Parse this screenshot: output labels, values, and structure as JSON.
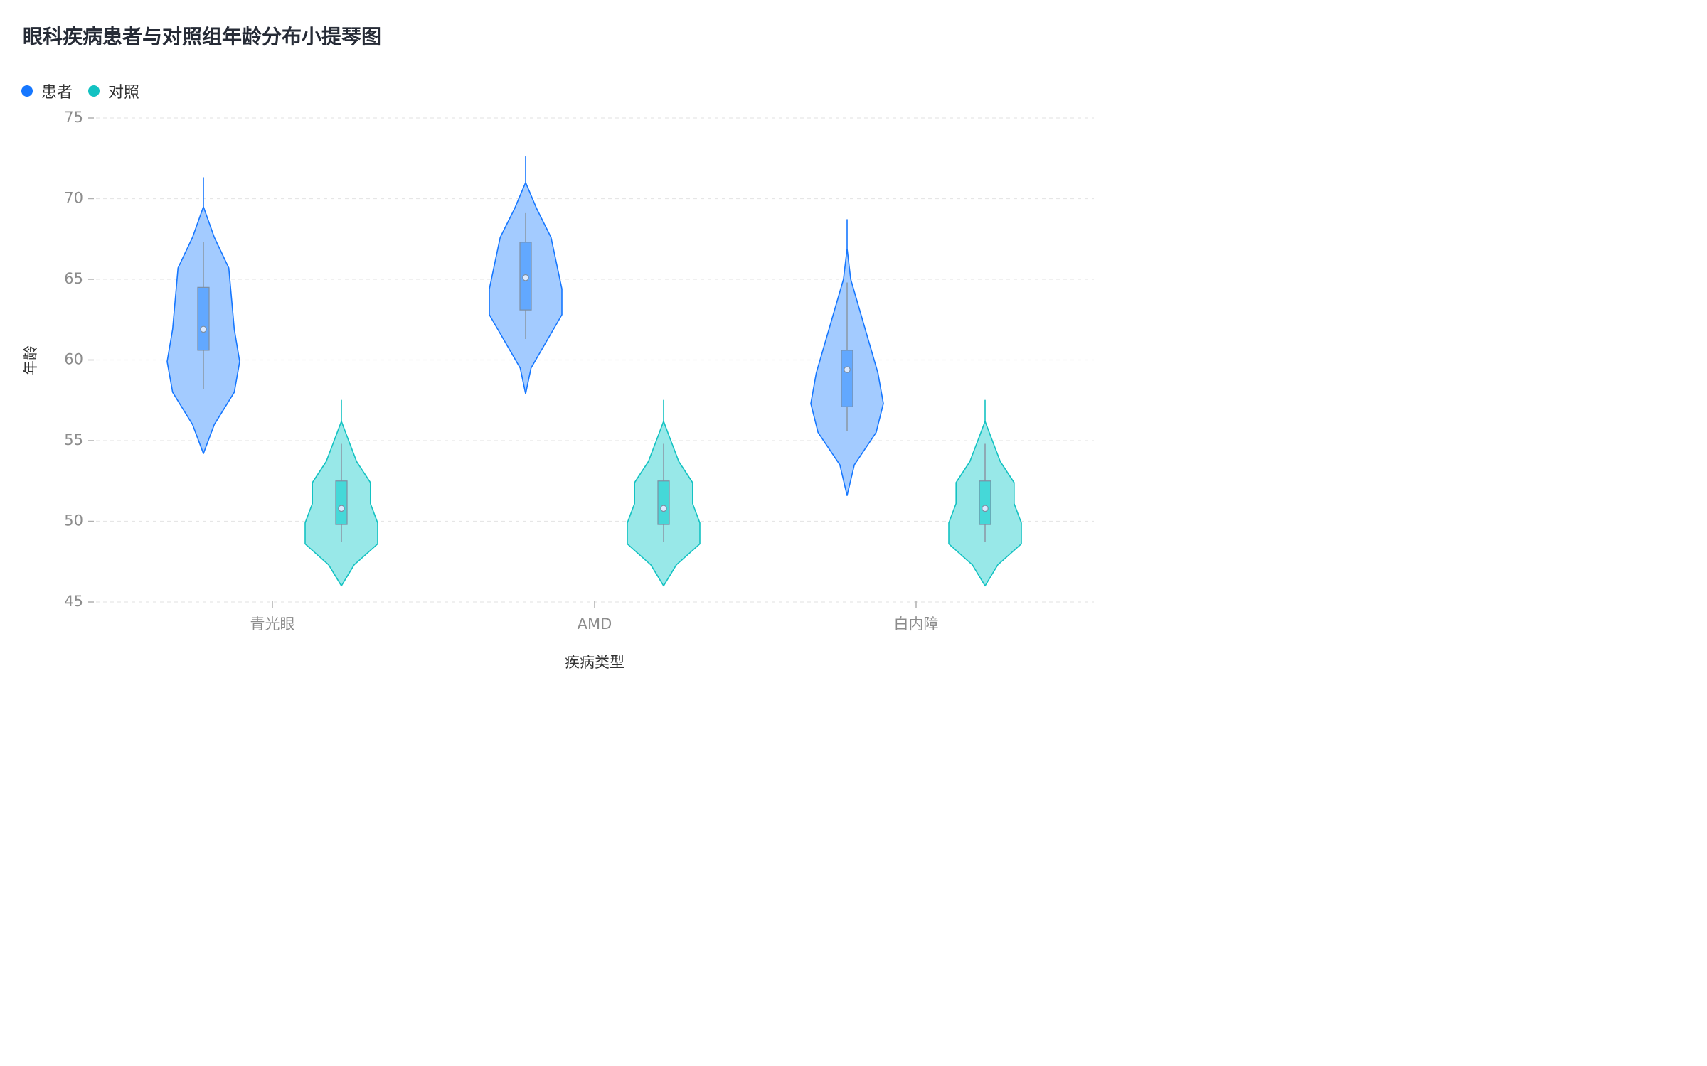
{
  "chart_data": {
    "type": "violin",
    "title": "眼科疾病患者与对照组年龄分布小提琴图",
    "xlabel": "疾病类型",
    "ylabel": "年龄",
    "ylim": [
      45,
      75
    ],
    "yticks": [
      45,
      50,
      55,
      60,
      65,
      70,
      75
    ],
    "grid": "horizontal dashed",
    "legend_position": "top-left",
    "categories": [
      "青光眼",
      "AMD",
      "白内障"
    ],
    "series": [
      {
        "name": "患者",
        "color": "#1677ff",
        "fill": "#a3cbff",
        "box_fill": "#62a8ff",
        "stats": [
          {
            "min": 54.2,
            "max": 71.3,
            "whisker_low": 58.2,
            "whisker_high": 67.3,
            "q1": 60.6,
            "q3": 64.5,
            "mean": 61.9,
            "density": [
              [
                54.2,
                0
              ],
              [
                56.0,
                0.3
              ],
              [
                58.0,
                0.85
              ],
              [
                59.9,
                1.0
              ],
              [
                61.9,
                0.85
              ],
              [
                65.7,
                0.7
              ],
              [
                67.6,
                0.3
              ],
              [
                69.5,
                0
              ],
              [
                71.3,
                0
              ]
            ]
          },
          {
            "min": 57.9,
            "max": 72.6,
            "whisker_low": 61.3,
            "whisker_high": 69.1,
            "q1": 63.1,
            "q3": 67.3,
            "mean": 65.1,
            "density": [
              [
                57.9,
                0
              ],
              [
                59.5,
                0.15
              ],
              [
                62.8,
                1.0
              ],
              [
                64.4,
                1.0
              ],
              [
                67.6,
                0.7
              ],
              [
                69.4,
                0.3
              ],
              [
                71.0,
                0
              ],
              [
                72.6,
                0
              ]
            ]
          },
          {
            "min": 51.6,
            "max": 68.7,
            "whisker_low": 55.6,
            "whisker_high": 64.8,
            "q1": 57.1,
            "q3": 60.6,
            "mean": 59.4,
            "density": [
              [
                51.6,
                0
              ],
              [
                53.5,
                0.2
              ],
              [
                55.5,
                0.8
              ],
              [
                57.3,
                1.0
              ],
              [
                59.2,
                0.85
              ],
              [
                65.0,
                0.1
              ],
              [
                66.9,
                0
              ],
              [
                68.7,
                0
              ]
            ]
          }
        ]
      },
      {
        "name": "对照",
        "color": "#13c2c2",
        "fill": "#98e8e8",
        "box_fill": "#45d8d8",
        "stats": [
          {
            "min": 46.0,
            "max": 57.5,
            "whisker_low": 48.7,
            "whisker_high": 54.8,
            "q1": 49.8,
            "q3": 52.5,
            "mean": 50.8,
            "density": [
              [
                46.0,
                0
              ],
              [
                47.3,
                0.35
              ],
              [
                48.6,
                1.0
              ],
              [
                49.9,
                1.0
              ],
              [
                51.1,
                0.8
              ],
              [
                52.4,
                0.8
              ],
              [
                53.7,
                0.42
              ],
              [
                55.0,
                0.2
              ],
              [
                56.2,
                0
              ],
              [
                57.5,
                0
              ]
            ]
          },
          {
            "min": 46.0,
            "max": 57.5,
            "whisker_low": 48.7,
            "whisker_high": 54.8,
            "q1": 49.8,
            "q3": 52.5,
            "mean": 50.8,
            "density": [
              [
                46.0,
                0
              ],
              [
                47.3,
                0.35
              ],
              [
                48.6,
                1.0
              ],
              [
                49.9,
                1.0
              ],
              [
                51.1,
                0.8
              ],
              [
                52.4,
                0.8
              ],
              [
                53.7,
                0.42
              ],
              [
                55.0,
                0.2
              ],
              [
                56.2,
                0
              ],
              [
                57.5,
                0
              ]
            ]
          },
          {
            "min": 46.0,
            "max": 57.5,
            "whisker_low": 48.7,
            "whisker_high": 54.8,
            "q1": 49.8,
            "q3": 52.5,
            "mean": 50.8,
            "density": [
              [
                46.0,
                0
              ],
              [
                47.3,
                0.35
              ],
              [
                48.6,
                1.0
              ],
              [
                49.9,
                1.0
              ],
              [
                51.1,
                0.8
              ],
              [
                52.4,
                0.8
              ],
              [
                53.7,
                0.42
              ],
              [
                55.0,
                0.2
              ],
              [
                56.2,
                0
              ],
              [
                57.5,
                0
              ]
            ]
          }
        ]
      }
    ]
  }
}
